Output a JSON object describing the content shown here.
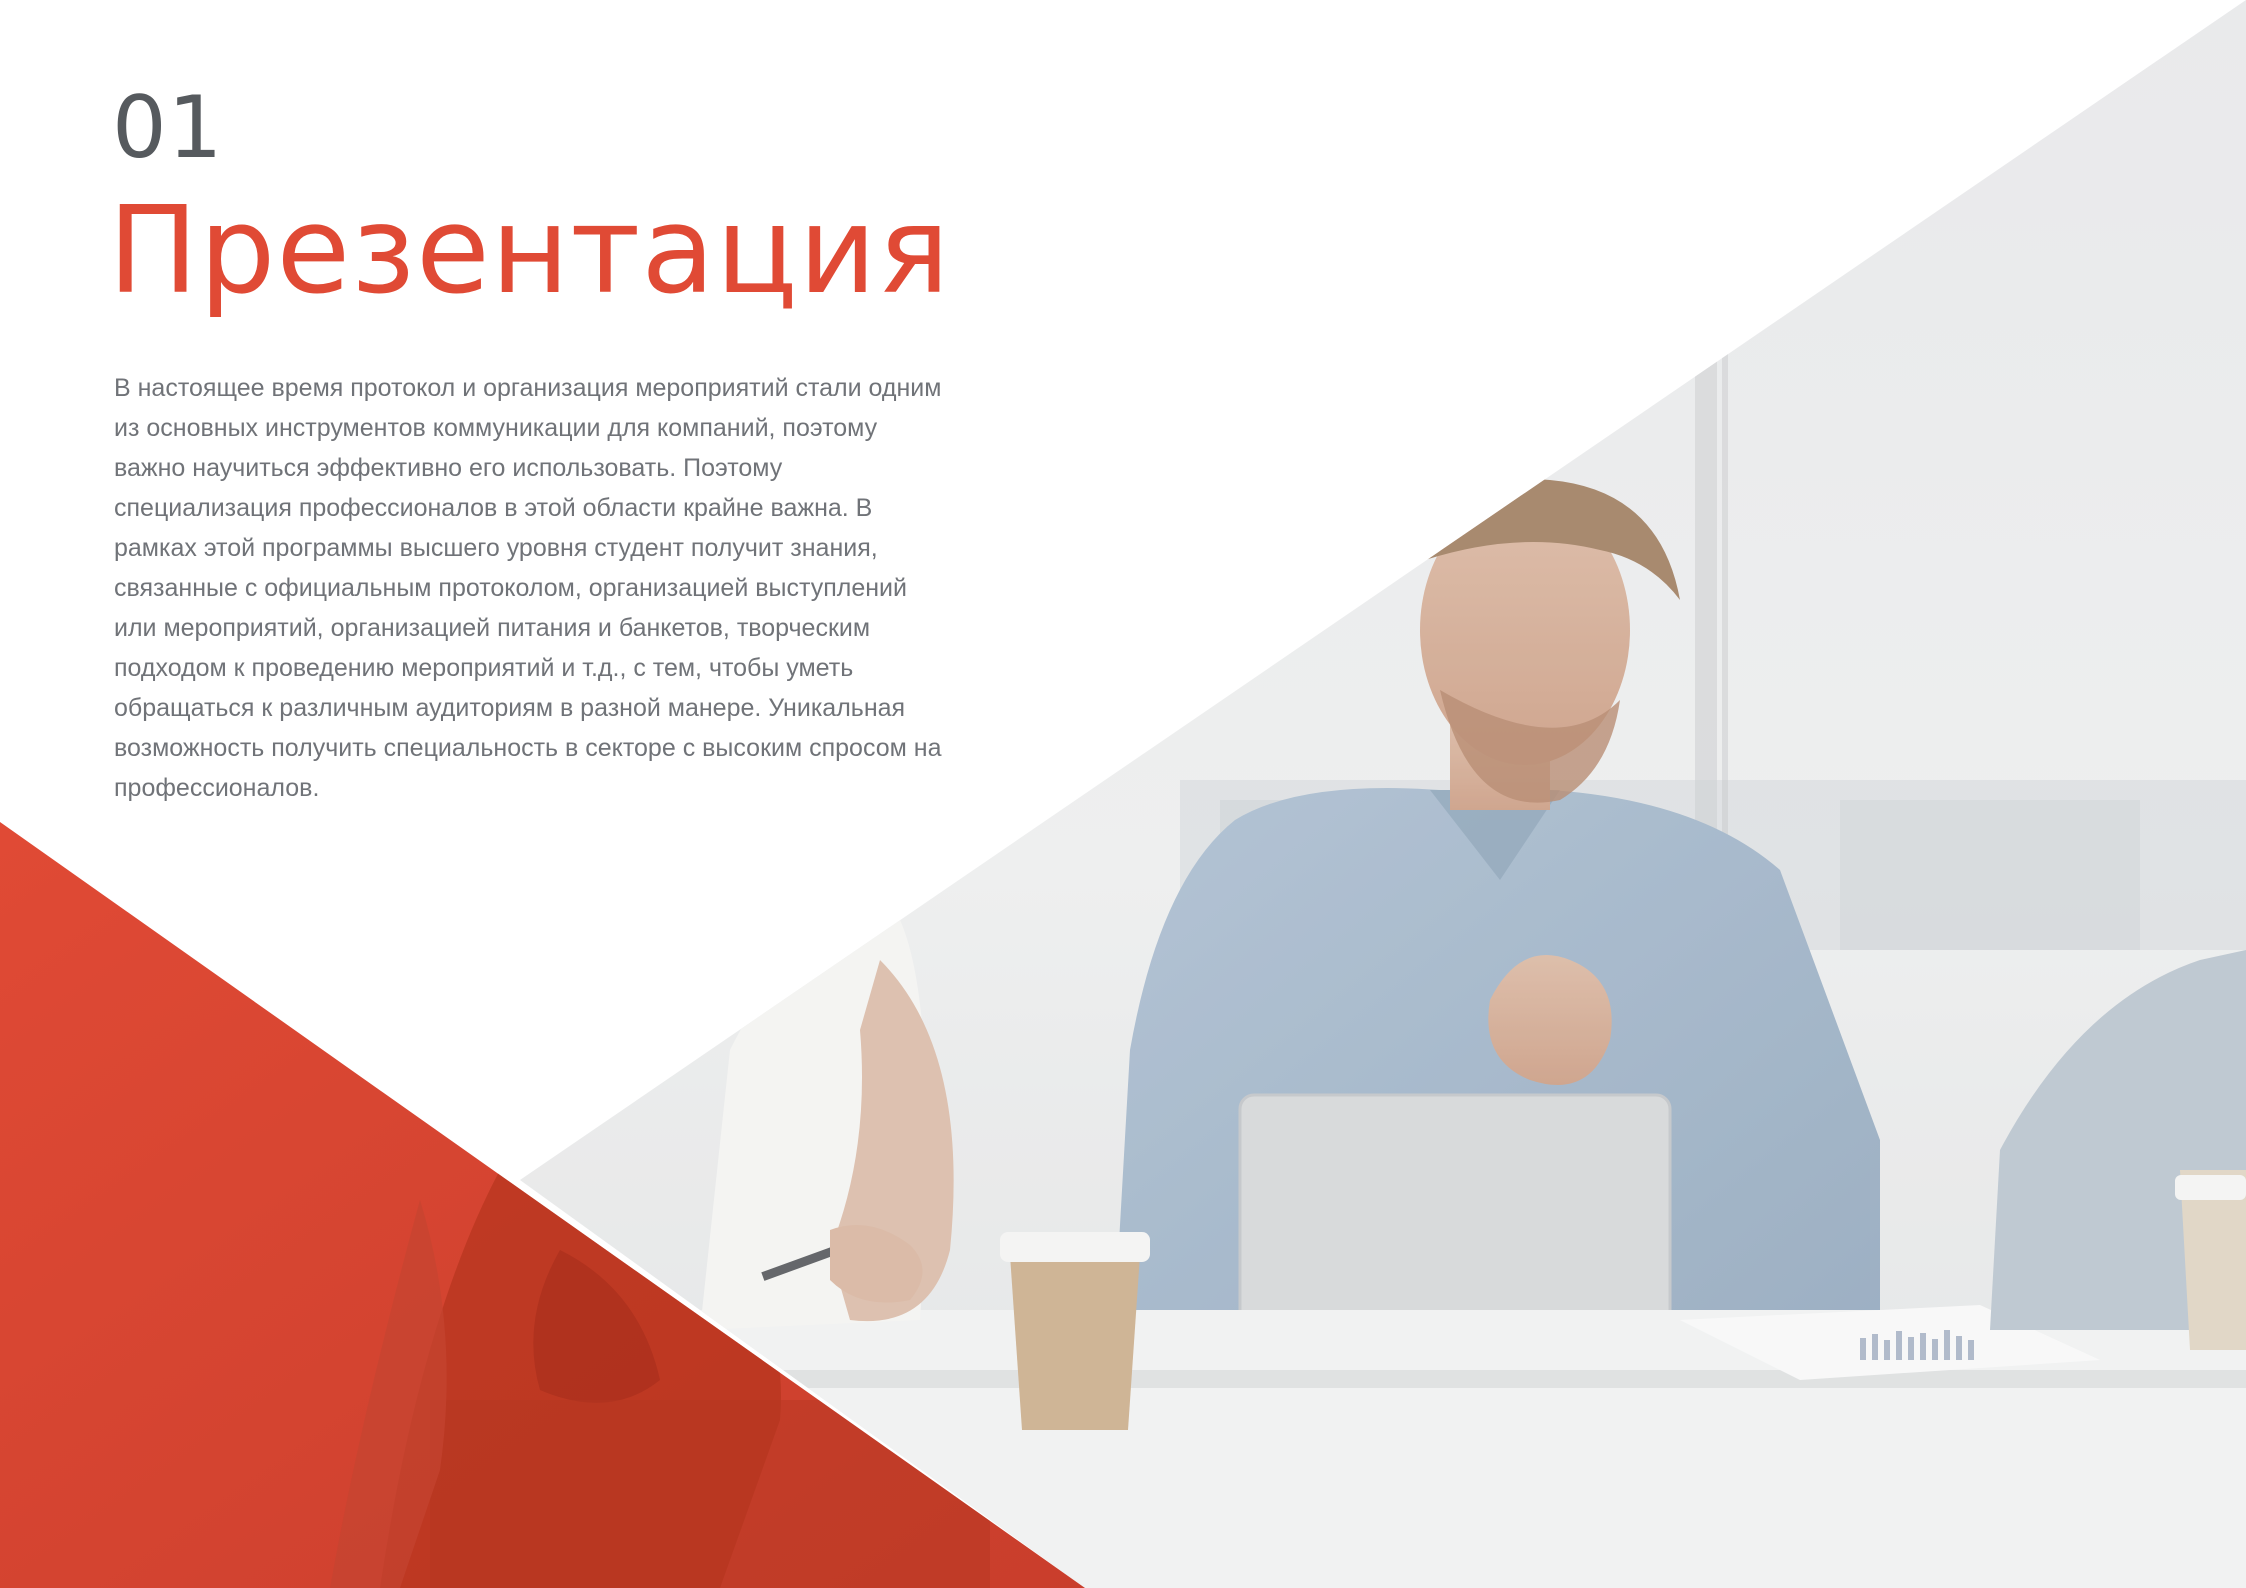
{
  "chapter": {
    "number": "01",
    "title": "Презентация"
  },
  "intro": {
    "text": "В настоящее время протокол и организация мероприятий стали одним из основных инструментов коммуникации для компаний, поэтому важно научиться эффективно его использовать. Поэтому специализация профессионалов в этой области крайне важна. В рамках этой программы высшего уровня студент получит знания, связанные с официальным протоколом, организацией выступлений или мероприятий, организацией питания и банкетов, творческим подходом к проведению мероприятий и т.д., с тем, чтобы уметь обращаться к различным аудиториям в разной манере. Уникальная возможность получить специальность в секторе с высоким спросом на профессионалов."
  },
  "colors": {
    "accent": "#e04a35",
    "number": "#565a5e",
    "body_text": "#707378",
    "background": "#ffffff"
  },
  "illustration": {
    "subject": "business-meeting-photo"
  }
}
